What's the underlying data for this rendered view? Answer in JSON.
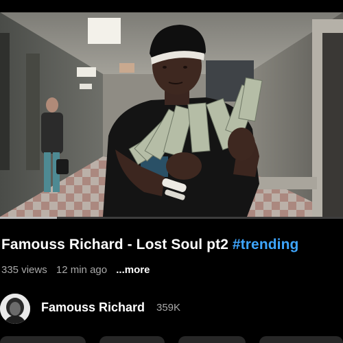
{
  "video": {
    "progress_fraction": 0.165
  },
  "title": {
    "text": "Famouss Richard - Lost Soul pt2",
    "hashtag": "#trending"
  },
  "meta": {
    "views": "335 views",
    "time_ago": "12 min ago",
    "more_label": "...more"
  },
  "channel": {
    "name": "Famouss Richard",
    "subscribers": "359K",
    "avatar_icon": "channel-avatar"
  },
  "colors": {
    "background": "#000000",
    "hashtag": "#3ea6ff",
    "secondary_text": "#aaaaaa",
    "chip_bg": "#272727"
  }
}
